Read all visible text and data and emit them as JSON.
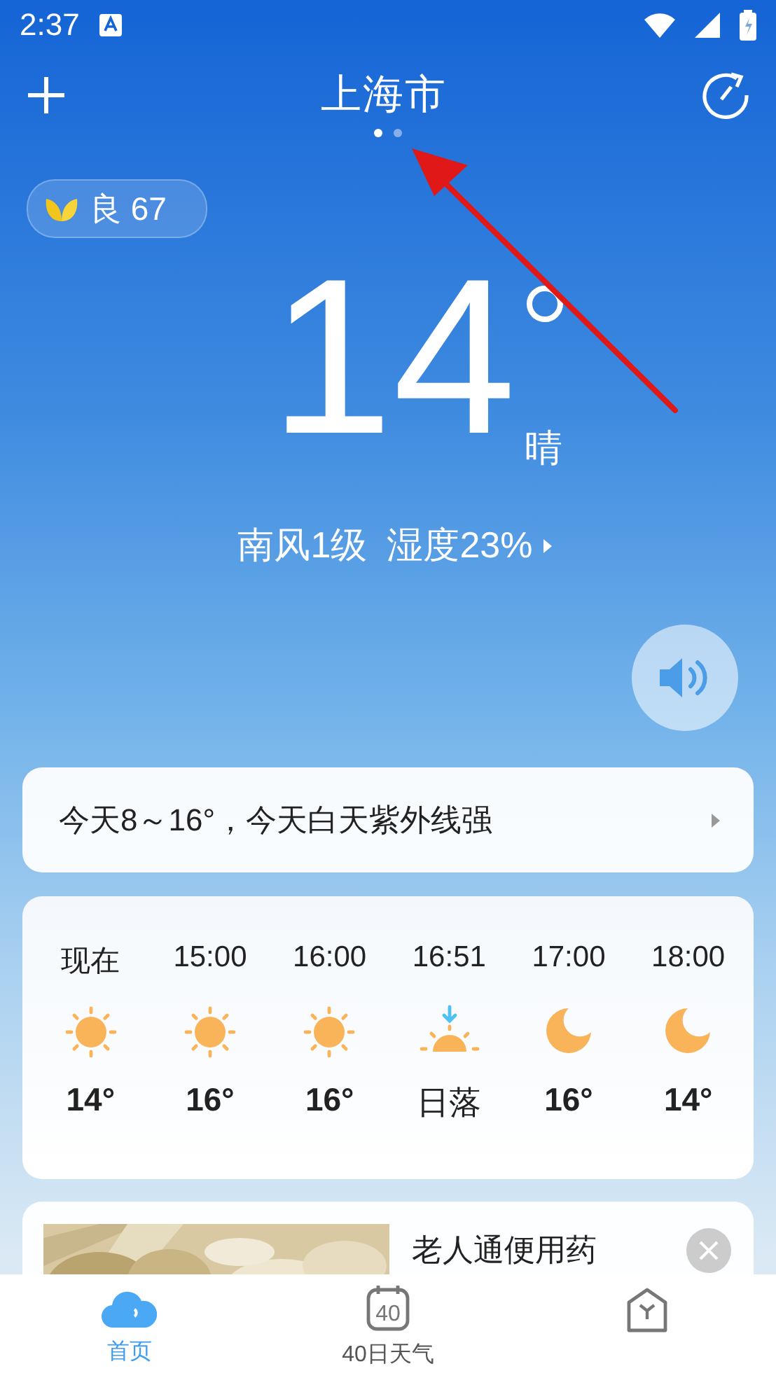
{
  "status_bar": {
    "time": "2:37"
  },
  "header": {
    "title": "上海市",
    "pages": [
      {
        "selected": true
      },
      {
        "selected": false
      }
    ]
  },
  "air_quality": {
    "label": "良 67"
  },
  "current": {
    "temperature": "14",
    "condition": "晴",
    "wind": "南风1级",
    "humidity": "湿度23%"
  },
  "summary": "今天8～16°，今天白天紫外线强",
  "hourly": [
    {
      "time": "现在",
      "value": "14°",
      "kind": "sun"
    },
    {
      "time": "15:00",
      "value": "16°",
      "kind": "sun"
    },
    {
      "time": "16:00",
      "value": "16°",
      "kind": "sun"
    },
    {
      "time": "16:51",
      "value": "日落",
      "kind": "sunset"
    },
    {
      "time": "17:00",
      "value": "16°",
      "kind": "moon"
    },
    {
      "time": "18:00",
      "value": "14°",
      "kind": "moon"
    }
  ],
  "ad": {
    "kind": "picture",
    "title": "老人通便用药"
  },
  "tabs": [
    {
      "label": "首页",
      "kind": "cloud",
      "selected": true
    },
    {
      "label": "40日天气",
      "kind": "calendar",
      "icon_text": "40",
      "selected": false
    },
    {
      "kind": "house",
      "selected": false
    }
  ]
}
